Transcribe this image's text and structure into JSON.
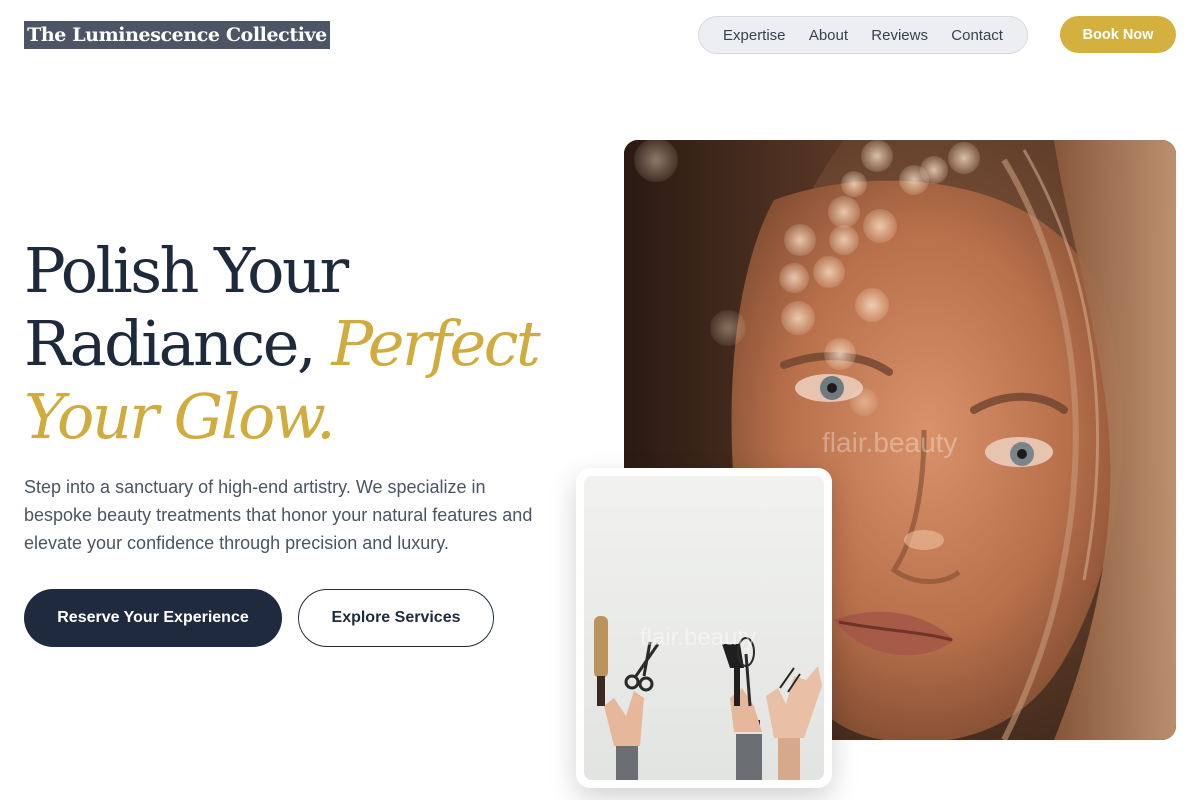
{
  "header": {
    "logo": "The Luminescence Collective",
    "nav": [
      "Expertise",
      "About",
      "Reviews",
      "Contact"
    ],
    "cta": "Book Now"
  },
  "hero": {
    "headline_line1": "Polish Your",
    "headline_line2a": "Radiance, ",
    "headline_line2b": "Perfect",
    "headline_line3": "Your Glow.",
    "lead": "Step into a sanctuary of high-end artistry. We specialize in bespoke beauty treatments that honor your natural features and elevate your confidence through precision and luxury.",
    "primary_button": "Reserve Your Experience",
    "secondary_button": "Explore Services"
  },
  "images": {
    "main_photo_watermark": "flair.beauty",
    "tools_photo_watermark": "flair.beauty"
  },
  "colors": {
    "accent_gold": "#d4b13e",
    "navy": "#1f2a3f",
    "logo_bg": "#4b5563"
  }
}
